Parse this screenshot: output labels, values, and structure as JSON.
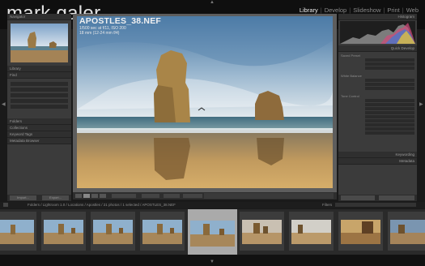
{
  "header": {
    "brand": "mark galer",
    "modules": [
      "Library",
      "Develop",
      "Slideshow",
      "Print",
      "Web"
    ],
    "active_module": "Library"
  },
  "left_panel": {
    "navigator_label": "Navigator",
    "sections": [
      "Library",
      "Find",
      "Folders",
      "Collections",
      "Keyword Tags",
      "Metadata Browser"
    ],
    "import_label": "Import...",
    "export_label": "Export..."
  },
  "right_panel": {
    "histogram_label": "Histogram",
    "quick_develop_label": "Quick Develop",
    "saved_preset_label": "Saved Preset",
    "white_balance_label": "White Balance",
    "tone_control_label": "Tone Control",
    "keywording_label": "Keywording",
    "metadata_label": "Metadata"
  },
  "photo": {
    "title": "APOSTLES_38.NEF",
    "meta_line1": "1/500 sec at f/11, ISO 200",
    "meta_line2": "18 mm (12-24 mm f/4)"
  },
  "filmstrip_bar": {
    "path": "Folders / Lightroom 1.0 / Locations / Apostles / 21 photos / 1 selected / APOSTLES_38.NEF",
    "filter_label": "Filters"
  },
  "colors": {
    "header_bg": "#0f0f0f",
    "panel_bg": "#3b3b3b",
    "center_bg": "#5d5d5d",
    "active_module": "#ececec"
  }
}
